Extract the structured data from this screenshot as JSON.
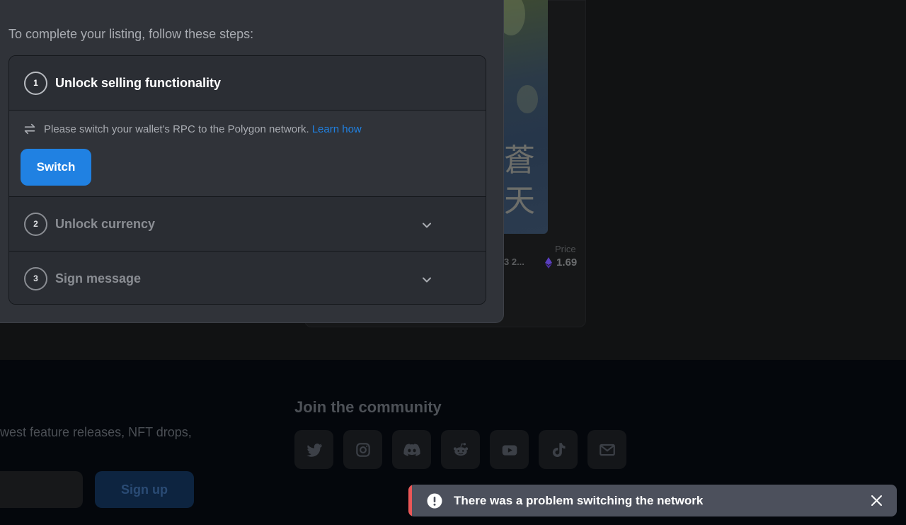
{
  "modal": {
    "intro": "To complete your listing, follow these steps:",
    "steps": [
      {
        "number": "1",
        "title": "Unlock selling functionality",
        "expanded": true,
        "message": "Please switch your wallet's RPC to the Polygon network.",
        "link_label": "Learn how",
        "button_label": "Switch"
      },
      {
        "number": "2",
        "title": "Unlock currency",
        "expanded": false
      },
      {
        "number": "3",
        "title": "Sign message",
        "expanded": false
      }
    ]
  },
  "background": {
    "item_name_fragment": "3 2...",
    "price_label": "Price",
    "price_value": "1.69",
    "art_glyphs": [
      "蒼",
      "天"
    ]
  },
  "footer": {
    "newsletter_text": "west feature releases, NFT drops,",
    "signup_label": "Sign up",
    "community_title": "Join the community",
    "social_icons": [
      "twitter-icon",
      "instagram-icon",
      "discord-icon",
      "reddit-icon",
      "youtube-icon",
      "tiktok-icon",
      "email-icon"
    ]
  },
  "toast": {
    "message": "There was a problem switching the network",
    "accent_color": "#eb5757"
  },
  "colors": {
    "accent": "#2081e2",
    "modal_bg": "#303339"
  }
}
